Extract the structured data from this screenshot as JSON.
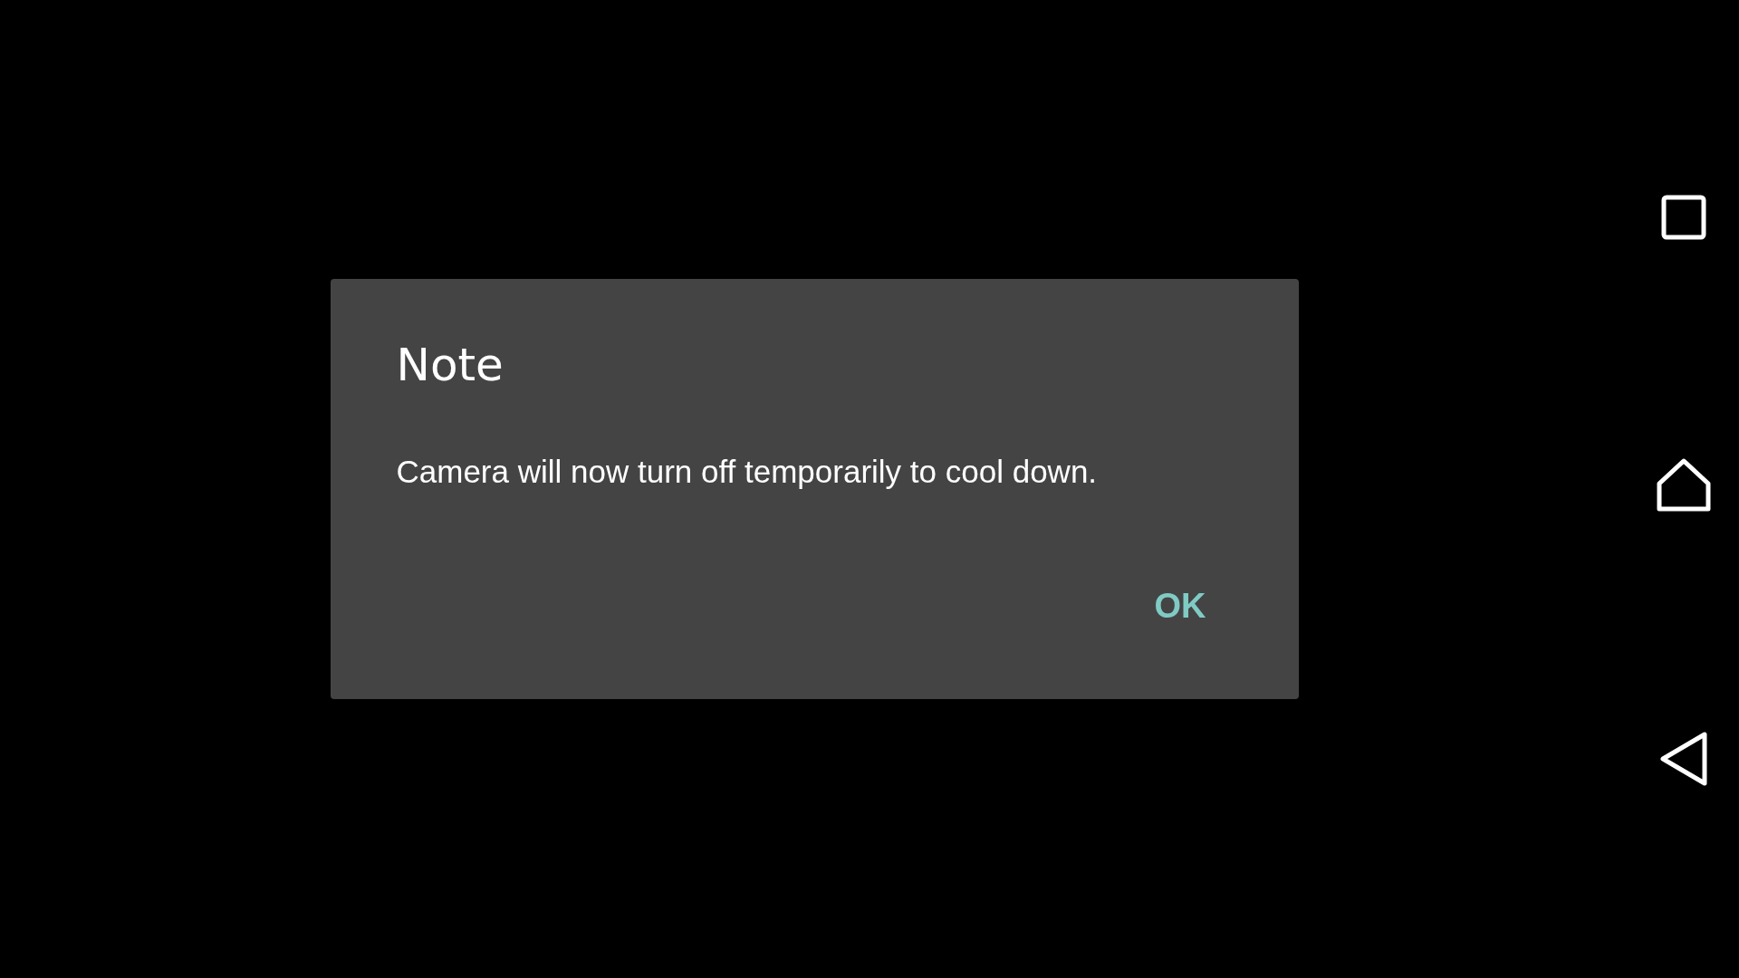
{
  "dialog": {
    "title": "Note",
    "message": "Camera will now turn off temporarily to cool down.",
    "buttons": [
      "OK"
    ]
  },
  "navigation_bar": {
    "buttons": [
      {
        "kind": "recents"
      },
      {
        "kind": "home"
      },
      {
        "kind": "back"
      }
    ]
  }
}
